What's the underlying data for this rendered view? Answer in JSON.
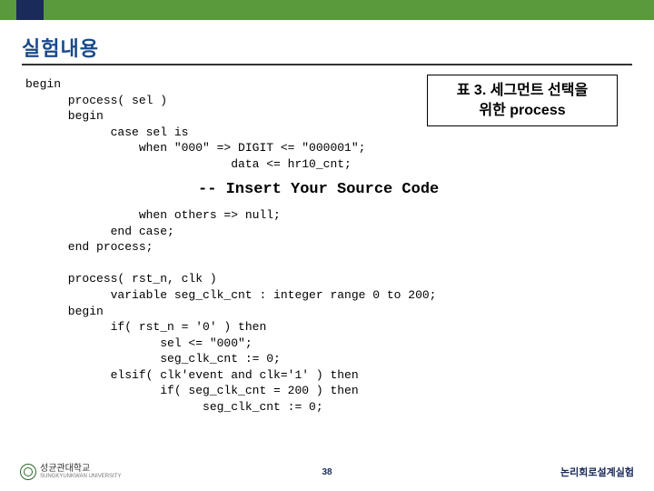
{
  "title": "실험내용",
  "callout": {
    "line1": "표 3. 세그먼트 선택을",
    "line2": "위한 process"
  },
  "code_top": "begin\n      process( sel )\n      begin\n            case sel is\n                when \"000\" => DIGIT <= \"000001\";\n                             data <= hr10_cnt;",
  "insert_text": "-- Insert Your Source Code",
  "code_mid": "                when others => null;\n            end case;\n      end process;\n\n      process( rst_n, clk )\n            variable seg_clk_cnt : integer range 0 to 200;\n      begin\n            if( rst_n = '0' ) then\n                   sel <= \"000\";\n                   seg_clk_cnt := 0;\n            elsif( clk'event and clk='1' ) then\n                   if( seg_clk_cnt = 200 ) then\n                         seg_clk_cnt := 0;",
  "footer": {
    "university": "성균관대학교",
    "university_sub": "SUNGKYUNKWAN UNIVERSITY",
    "page": "38",
    "right": "논리회로설계실험"
  }
}
